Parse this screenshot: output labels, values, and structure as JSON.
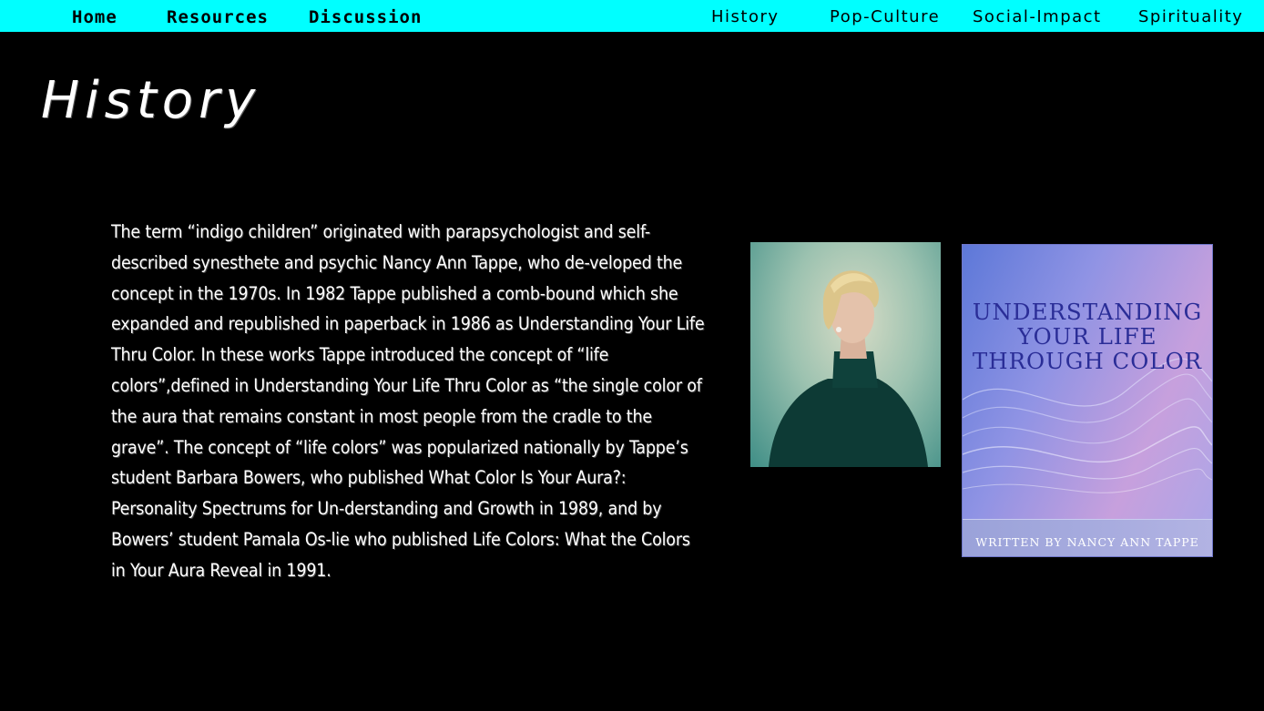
{
  "nav": {
    "left": [
      "Home",
      "Resources",
      "Discussion"
    ],
    "right": [
      "History",
      "Pop-Culture",
      "Social-Impact",
      "Spirituality"
    ]
  },
  "page": {
    "title": "History",
    "body": "The term “indigo children” originated with parapsychologist and self-described synesthete and psychic Nancy Ann Tappe, who de-veloped the concept in the 1970s.  In 1982 Tappe published a comb-bound which she expanded and republished in paperback in 1986 as Understanding Your Life Thru Color.  In these works Tappe introduced the concept of “life colors”,defined in Understanding Your Life Thru Color as “the single color of the aura that remains constant in most people from the cradle to the grave”. The concept of “life colors” was popularized nationally by Tappe’s student Barbara Bowers, who published What Color Is Your Aura?: Personality Spectrums for Un-derstanding and Growth in 1989, and by Bowers’ student Pamala Os-lie who published Life Colors: What the Colors in Your Aura Reveal in 1991."
  },
  "book_cover": {
    "title_lines": [
      "UNDERSTANDING",
      "YOUR LIFE",
      "THROUGH COLOR"
    ],
    "author": "WRITTEN BY NANCY ANN TAPPE"
  },
  "colors": {
    "nav_bar": "#00ffff",
    "background": "#000000",
    "text": "#ffffff"
  }
}
